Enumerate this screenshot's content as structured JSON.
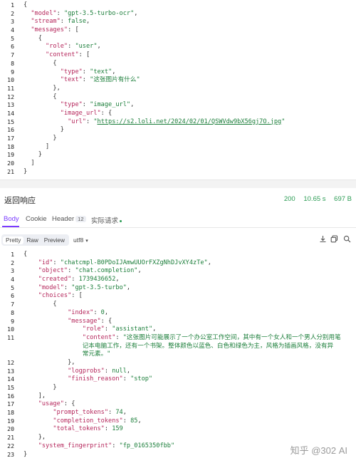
{
  "request": {
    "lines": [
      {
        "n": "1",
        "segs": [
          {
            "c": "pun",
            "t": "{"
          }
        ]
      },
      {
        "n": "2",
        "segs": [
          {
            "c": "pun",
            "t": "  "
          },
          {
            "c": "key",
            "t": "\"model\""
          },
          {
            "c": "pun",
            "t": ": "
          },
          {
            "c": "str",
            "t": "\"gpt-3.5-turbo-ocr\""
          },
          {
            "c": "pun",
            "t": ","
          }
        ]
      },
      {
        "n": "3",
        "segs": [
          {
            "c": "pun",
            "t": "  "
          },
          {
            "c": "key",
            "t": "\"stream\""
          },
          {
            "c": "pun",
            "t": ": "
          },
          {
            "c": "bool",
            "t": "false"
          },
          {
            "c": "pun",
            "t": ","
          }
        ]
      },
      {
        "n": "4",
        "segs": [
          {
            "c": "pun",
            "t": "  "
          },
          {
            "c": "key",
            "t": "\"messages\""
          },
          {
            "c": "pun",
            "t": ": ["
          }
        ]
      },
      {
        "n": "5",
        "segs": [
          {
            "c": "pun",
            "t": "    {"
          }
        ]
      },
      {
        "n": "6",
        "segs": [
          {
            "c": "pun",
            "t": "      "
          },
          {
            "c": "key",
            "t": "\"role\""
          },
          {
            "c": "pun",
            "t": ": "
          },
          {
            "c": "str",
            "t": "\"user\""
          },
          {
            "c": "pun",
            "t": ","
          }
        ]
      },
      {
        "n": "7",
        "segs": [
          {
            "c": "pun",
            "t": "      "
          },
          {
            "c": "key",
            "t": "\"content\""
          },
          {
            "c": "pun",
            "t": ": ["
          }
        ]
      },
      {
        "n": "8",
        "segs": [
          {
            "c": "pun",
            "t": "        {"
          }
        ]
      },
      {
        "n": "9",
        "segs": [
          {
            "c": "pun",
            "t": "          "
          },
          {
            "c": "key",
            "t": "\"type\""
          },
          {
            "c": "pun",
            "t": ": "
          },
          {
            "c": "str",
            "t": "\"text\""
          },
          {
            "c": "pun",
            "t": ","
          }
        ]
      },
      {
        "n": "10",
        "segs": [
          {
            "c": "pun",
            "t": "          "
          },
          {
            "c": "key",
            "t": "\"text\""
          },
          {
            "c": "pun",
            "t": ": "
          },
          {
            "c": "str",
            "t": "\"这张图片有什么\""
          }
        ]
      },
      {
        "n": "11",
        "segs": [
          {
            "c": "pun",
            "t": "        },"
          }
        ]
      },
      {
        "n": "12",
        "segs": [
          {
            "c": "pun",
            "t": "        {"
          }
        ]
      },
      {
        "n": "13",
        "segs": [
          {
            "c": "pun",
            "t": "          "
          },
          {
            "c": "key",
            "t": "\"type\""
          },
          {
            "c": "pun",
            "t": ": "
          },
          {
            "c": "str",
            "t": "\"image_url\""
          },
          {
            "c": "pun",
            "t": ","
          }
        ]
      },
      {
        "n": "14",
        "segs": [
          {
            "c": "pun",
            "t": "          "
          },
          {
            "c": "key",
            "t": "\"image_url\""
          },
          {
            "c": "pun",
            "t": ": {"
          }
        ]
      },
      {
        "n": "15",
        "segs": [
          {
            "c": "pun",
            "t": "            "
          },
          {
            "c": "key",
            "t": "\"url\""
          },
          {
            "c": "pun",
            "t": ": "
          },
          {
            "c": "str",
            "t": "\""
          },
          {
            "c": "lnk",
            "t": "https://s2.loli.net/2024/02/01/QSWVdw9bX56gj7O.jpg"
          },
          {
            "c": "str",
            "t": "\""
          }
        ]
      },
      {
        "n": "16",
        "segs": [
          {
            "c": "pun",
            "t": "          }"
          }
        ]
      },
      {
        "n": "17",
        "segs": [
          {
            "c": "pun",
            "t": "        }"
          }
        ]
      },
      {
        "n": "18",
        "segs": [
          {
            "c": "pun",
            "t": "      ]"
          }
        ]
      },
      {
        "n": "19",
        "segs": [
          {
            "c": "pun",
            "t": "    }"
          }
        ]
      },
      {
        "n": "20",
        "segs": [
          {
            "c": "pun",
            "t": "  ]"
          }
        ]
      },
      {
        "n": "21",
        "segs": [
          {
            "c": "pun",
            "t": "}"
          }
        ]
      }
    ]
  },
  "response_header": {
    "title": "返回响应",
    "status": "200",
    "time": "10.65 s",
    "size": "697 B"
  },
  "tabs": [
    {
      "label": "Body",
      "active": true
    },
    {
      "label": "Cookie",
      "active": false
    },
    {
      "label": "Header",
      "badge": "12",
      "active": false
    },
    {
      "label": "实际请求",
      "dot": true,
      "active": false
    }
  ],
  "toolbar": {
    "views": [
      {
        "label": "Pretty",
        "selected": true
      },
      {
        "label": "Raw",
        "selected": false
      },
      {
        "label": "Preview",
        "selected": false
      }
    ],
    "encoding": "utf8",
    "icons": [
      "download-icon",
      "copy-icon",
      "search-icon"
    ]
  },
  "response": {
    "lines": [
      {
        "n": "1",
        "segs": [
          {
            "c": "pun",
            "t": "{"
          }
        ]
      },
      {
        "n": "2",
        "segs": [
          {
            "c": "pun",
            "t": "    "
          },
          {
            "c": "key",
            "t": "\"id\""
          },
          {
            "c": "pun",
            "t": ": "
          },
          {
            "c": "str",
            "t": "\"chatcmpl-B0PDoIJAmwUUOrFXZgNhDJvXY4zTe\""
          },
          {
            "c": "pun",
            "t": ","
          }
        ]
      },
      {
        "n": "3",
        "segs": [
          {
            "c": "pun",
            "t": "    "
          },
          {
            "c": "key",
            "t": "\"object\""
          },
          {
            "c": "pun",
            "t": ": "
          },
          {
            "c": "str",
            "t": "\"chat.completion\""
          },
          {
            "c": "pun",
            "t": ","
          }
        ]
      },
      {
        "n": "4",
        "segs": [
          {
            "c": "pun",
            "t": "    "
          },
          {
            "c": "key",
            "t": "\"created\""
          },
          {
            "c": "pun",
            "t": ": "
          },
          {
            "c": "num",
            "t": "1739436652"
          },
          {
            "c": "pun",
            "t": ","
          }
        ]
      },
      {
        "n": "5",
        "segs": [
          {
            "c": "pun",
            "t": "    "
          },
          {
            "c": "key",
            "t": "\"model\""
          },
          {
            "c": "pun",
            "t": ": "
          },
          {
            "c": "str",
            "t": "\"gpt-3.5-turbo\""
          },
          {
            "c": "pun",
            "t": ","
          }
        ]
      },
      {
        "n": "6",
        "segs": [
          {
            "c": "pun",
            "t": "    "
          },
          {
            "c": "key",
            "t": "\"choices\""
          },
          {
            "c": "pun",
            "t": ": ["
          }
        ]
      },
      {
        "n": "7",
        "segs": [
          {
            "c": "pun",
            "t": "        {"
          }
        ]
      },
      {
        "n": "8",
        "segs": [
          {
            "c": "pun",
            "t": "            "
          },
          {
            "c": "key",
            "t": "\"index\""
          },
          {
            "c": "pun",
            "t": ": "
          },
          {
            "c": "num",
            "t": "0"
          },
          {
            "c": "pun",
            "t": ","
          }
        ]
      },
      {
        "n": "9",
        "segs": [
          {
            "c": "pun",
            "t": "            "
          },
          {
            "c": "key",
            "t": "\"message\""
          },
          {
            "c": "pun",
            "t": ": {"
          }
        ]
      },
      {
        "n": "10",
        "segs": [
          {
            "c": "pun",
            "t": "                "
          },
          {
            "c": "key",
            "t": "\"role\""
          },
          {
            "c": "pun",
            "t": ": "
          },
          {
            "c": "str",
            "t": "\"assistant\""
          },
          {
            "c": "pun",
            "t": ","
          }
        ]
      },
      {
        "n": "11",
        "segs": [
          {
            "c": "pun",
            "t": "                "
          },
          {
            "c": "key",
            "t": "\"content\""
          },
          {
            "c": "pun",
            "t": ": "
          },
          {
            "c": "str",
            "t": "\"这张图片可能展示了一个办公室工作空间，其中有一个女人和一个男人分别用笔"
          }
        ]
      },
      {
        "n": "",
        "segs": [
          {
            "c": "str",
            "t": "                记本电脑工作，还有一个书架。整体颜色以蓝色、白色和绿色为主，风格为插画风格，没有异"
          }
        ]
      },
      {
        "n": "",
        "segs": [
          {
            "c": "str",
            "t": "                常元素。\""
          }
        ]
      },
      {
        "n": "12",
        "segs": [
          {
            "c": "pun",
            "t": "            },"
          }
        ]
      },
      {
        "n": "13",
        "segs": [
          {
            "c": "pun",
            "t": "            "
          },
          {
            "c": "key",
            "t": "\"logprobs\""
          },
          {
            "c": "pun",
            "t": ": "
          },
          {
            "c": "bool",
            "t": "null"
          },
          {
            "c": "pun",
            "t": ","
          }
        ]
      },
      {
        "n": "14",
        "segs": [
          {
            "c": "pun",
            "t": "            "
          },
          {
            "c": "key",
            "t": "\"finish_reason\""
          },
          {
            "c": "pun",
            "t": ": "
          },
          {
            "c": "str",
            "t": "\"stop\""
          }
        ]
      },
      {
        "n": "15",
        "segs": [
          {
            "c": "pun",
            "t": "        }"
          }
        ]
      },
      {
        "n": "16",
        "segs": [
          {
            "c": "pun",
            "t": "    ],"
          }
        ]
      },
      {
        "n": "17",
        "segs": [
          {
            "c": "pun",
            "t": "    "
          },
          {
            "c": "key",
            "t": "\"usage\""
          },
          {
            "c": "pun",
            "t": ": {"
          }
        ]
      },
      {
        "n": "18",
        "segs": [
          {
            "c": "pun",
            "t": "        "
          },
          {
            "c": "key",
            "t": "\"prompt_tokens\""
          },
          {
            "c": "pun",
            "t": ": "
          },
          {
            "c": "num",
            "t": "74"
          },
          {
            "c": "pun",
            "t": ","
          }
        ]
      },
      {
        "n": "19",
        "segs": [
          {
            "c": "pun",
            "t": "        "
          },
          {
            "c": "key",
            "t": "\"completion_tokens\""
          },
          {
            "c": "pun",
            "t": ": "
          },
          {
            "c": "num",
            "t": "85"
          },
          {
            "c": "pun",
            "t": ","
          }
        ]
      },
      {
        "n": "20",
        "segs": [
          {
            "c": "pun",
            "t": "        "
          },
          {
            "c": "key",
            "t": "\"total_tokens\""
          },
          {
            "c": "pun",
            "t": ": "
          },
          {
            "c": "num",
            "t": "159"
          }
        ]
      },
      {
        "n": "21",
        "segs": [
          {
            "c": "pun",
            "t": "    },"
          }
        ]
      },
      {
        "n": "22",
        "segs": [
          {
            "c": "pun",
            "t": "    "
          },
          {
            "c": "key",
            "t": "\"system_fingerprint\""
          },
          {
            "c": "pun",
            "t": ": "
          },
          {
            "c": "str",
            "t": "\"fp_0165350fbb\""
          }
        ]
      },
      {
        "n": "23",
        "segs": [
          {
            "c": "pun",
            "t": "}"
          }
        ]
      }
    ]
  },
  "watermark": "知乎 @302 AI"
}
